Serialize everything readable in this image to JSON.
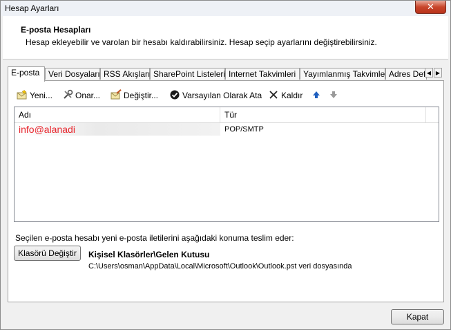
{
  "window": {
    "title": "Hesap Ayarları",
    "close_glyph": "✕"
  },
  "header": {
    "title": "E-posta Hesapları",
    "description": "Hesap ekleyebilir ve varolan bir hesabı kaldırabilirsiniz. Hesap seçip ayarlarını değiştirebilirsiniz."
  },
  "tabs": [
    {
      "label": "E-posta",
      "active": true
    },
    {
      "label": "Veri Dosyaları"
    },
    {
      "label": "RSS Akışları"
    },
    {
      "label": "SharePoint Listeleri"
    },
    {
      "label": "Internet Takvimleri"
    },
    {
      "label": "Yayımlanmış Takvimler"
    },
    {
      "label": "Adres Def"
    }
  ],
  "toolbar": {
    "new_label": "Yeni...",
    "repair_label": "Onar...",
    "change_label": "Değiştir...",
    "default_label": "Varsayılan Olarak Ata",
    "remove_label": "Kaldır"
  },
  "accounts_table": {
    "columns": [
      "Adı",
      "Tür"
    ],
    "rows": [
      {
        "name": "info@alanadi",
        "type": "POP/SMTP"
      }
    ]
  },
  "delivery": {
    "label": "Seçilen e-posta hesabı yeni e-posta iletilerini aşağıdaki konuma teslim eder:",
    "change_folder_label": "Klasörü Değiştir",
    "folder": "Kişisel Klasörler\\Gelen Kutusu",
    "file": "C:\\Users\\osman\\AppData\\Local\\Microsoft\\Outlook\\Outlook.pst veri dosyasında"
  },
  "footer": {
    "close_label": "Kapat"
  },
  "colors": {
    "account_name": "#e8262d",
    "accent_blue": "#1f5fbf",
    "window_bg": "#f0f0f0"
  }
}
